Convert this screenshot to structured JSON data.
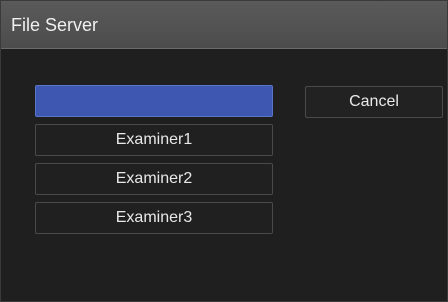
{
  "window": {
    "title": "File Server"
  },
  "list": {
    "items": [
      {
        "label": "",
        "selected": true
      },
      {
        "label": "Examiner1",
        "selected": false
      },
      {
        "label": "Examiner2",
        "selected": false
      },
      {
        "label": "Examiner3",
        "selected": false
      }
    ]
  },
  "buttons": {
    "cancel_label": "Cancel"
  },
  "colors": {
    "selected_item": "#3e58b2",
    "titlebar": "#555555",
    "background": "#1f1f1f"
  }
}
